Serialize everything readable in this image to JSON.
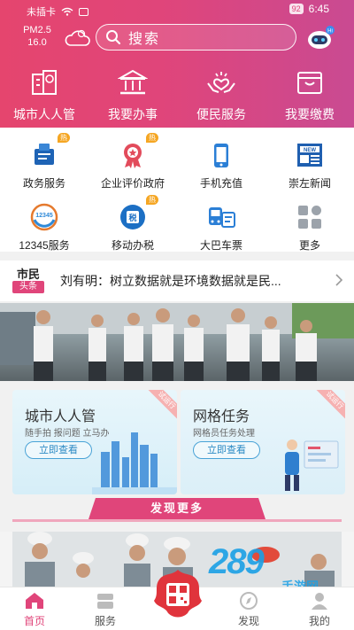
{
  "status_bar": {
    "carrier": "未插卡",
    "battery": "92",
    "time": "6:45"
  },
  "header": {
    "pm_label": "PM2.5",
    "pm_value": "16.0",
    "search_placeholder": "搜索",
    "robot_badge": "Hi"
  },
  "top_nav": [
    {
      "label": "城市人人管",
      "icon": "city-management-icon"
    },
    {
      "label": "我要办事",
      "icon": "government-building-icon"
    },
    {
      "label": "便民服务",
      "icon": "hand-heart-icon"
    },
    {
      "label": "我要缴费",
      "icon": "wallet-icon"
    }
  ],
  "services": [
    {
      "label": "政务服务",
      "icon": "government-affairs-icon",
      "badge": "热"
    },
    {
      "label": "企业评价政府",
      "icon": "award-icon",
      "badge": "热"
    },
    {
      "label": "手机充值",
      "icon": "phone-icon",
      "badge": ""
    },
    {
      "label": "崇左新闻",
      "icon": "newspaper-icon",
      "badge": ""
    },
    {
      "label": "12345服务",
      "icon": "hotline-icon",
      "badge": ""
    },
    {
      "label": "移动办税",
      "icon": "tax-icon",
      "badge": "热"
    },
    {
      "label": "大巴车票",
      "icon": "bus-ticket-icon",
      "badge": ""
    },
    {
      "label": "更多",
      "icon": "more-grid-icon",
      "badge": ""
    }
  ],
  "news": {
    "logo_top": "市民",
    "logo_bottom": "头条",
    "headline": "刘有明：树立数据就是环境数据就是民..."
  },
  "cards": [
    {
      "title": "城市人人管",
      "subtitle": "随手拍 报问题 立马办",
      "button": "立即查看",
      "ribbon": "试运行"
    },
    {
      "title": "网格任务",
      "subtitle": "网格员任务处理",
      "button": "立即查看",
      "ribbon": "试运行"
    }
  ],
  "section_title": "发现更多",
  "tabs": [
    {
      "label": "首页",
      "icon": "home-icon",
      "active": true
    },
    {
      "label": "服务",
      "icon": "services-icon",
      "active": false
    },
    {
      "label": "发现",
      "icon": "discover-icon",
      "active": false
    },
    {
      "label": "我的",
      "icon": "profile-icon",
      "active": false
    }
  ],
  "watermark": {
    "logo": "289",
    "text": "手游网"
  },
  "colors": {
    "accent": "#e0457a",
    "accent_light": "#f0a7bd",
    "card_blue": "#2b8ac4",
    "hot_badge": "#f5a623"
  }
}
